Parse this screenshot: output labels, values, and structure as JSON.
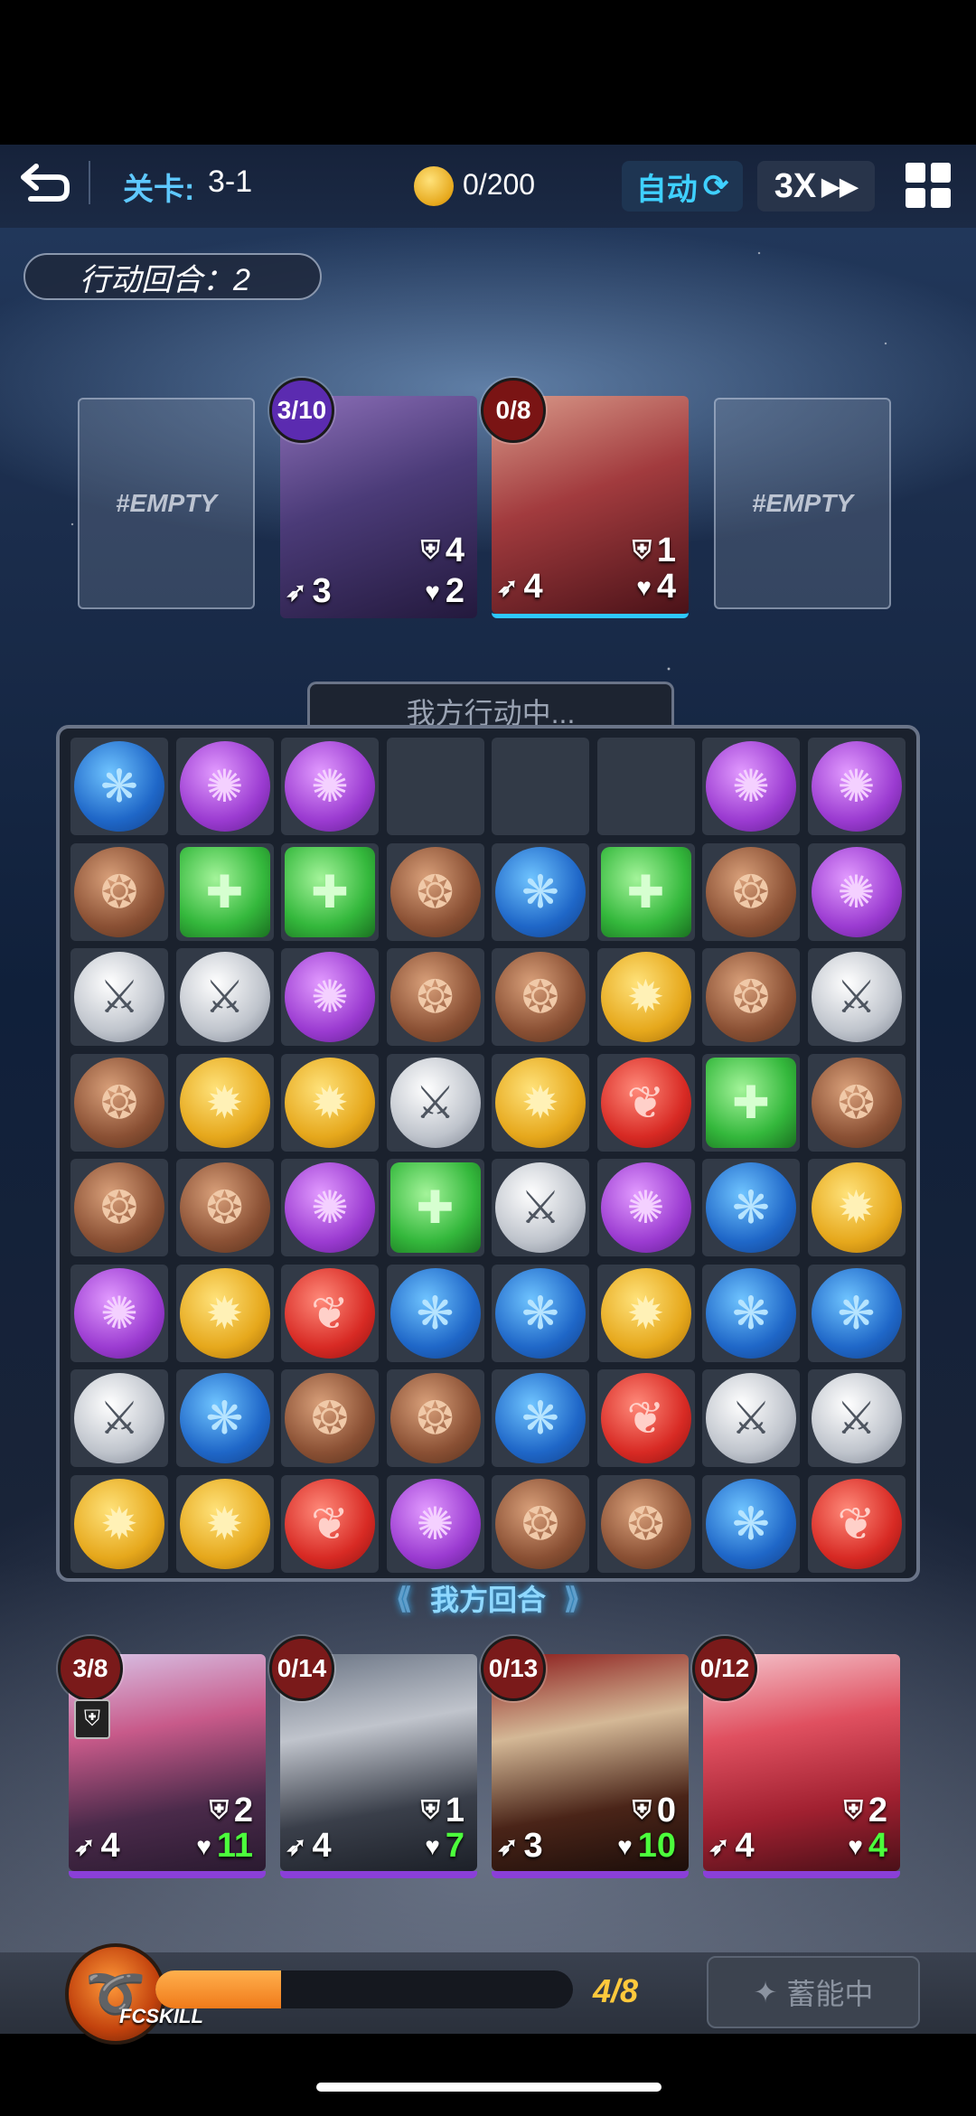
{
  "top_bar": {
    "level_label": "关卡:",
    "level_value": "3-1",
    "coins": "0/200",
    "auto_label": "自动",
    "speed_label": "3X"
  },
  "turn_counter": "行动回合：2",
  "enemies": {
    "empty_left": "#EMPTY",
    "empty_right": "#EMPTY",
    "enemy1": {
      "charge": "3/10",
      "shield": "4",
      "speed": "3",
      "hp": "2"
    },
    "enemy2": {
      "charge": "0/8",
      "shield": "1",
      "speed": "4",
      "hp": "4"
    }
  },
  "board": {
    "header": "我方行动中...",
    "footer": "我方回合",
    "grid": [
      [
        "blue",
        "purple",
        "purple",
        "",
        "",
        "",
        "purple",
        "purple"
      ],
      [
        "brown",
        "green",
        "green",
        "brown",
        "blue",
        "green",
        "brown",
        "purple"
      ],
      [
        "silver",
        "silver",
        "purple",
        "brown",
        "brown",
        "gold",
        "brown",
        "silver"
      ],
      [
        "brown",
        "gold",
        "gold",
        "silver",
        "gold",
        "red",
        "green",
        "brown"
      ],
      [
        "brown",
        "brown",
        "purple",
        "green",
        "silver",
        "purple",
        "blue",
        "gold"
      ],
      [
        "purple",
        "gold",
        "red",
        "blue",
        "blue",
        "gold",
        "blue",
        "blue"
      ],
      [
        "silver",
        "blue",
        "brown",
        "brown",
        "blue",
        "red",
        "silver",
        "silver"
      ],
      [
        "gold",
        "gold",
        "red",
        "purple",
        "brown",
        "brown",
        "blue",
        "red"
      ]
    ]
  },
  "heroes": [
    {
      "charge": "3/8",
      "shield": "2",
      "speed": "4",
      "hp": "11"
    },
    {
      "charge": "0/14",
      "shield": "1",
      "speed": "4",
      "hp": "7"
    },
    {
      "charge": "0/13",
      "shield": "0",
      "speed": "3",
      "hp": "10"
    },
    {
      "charge": "0/12",
      "shield": "2",
      "speed": "4",
      "hp": "4"
    }
  ],
  "skill": {
    "emblem_label": "FCSKILL",
    "energy_text": "4/8",
    "energy_fraction": 0.3,
    "charge_button": "蓄能中"
  },
  "colors": {
    "accent_cyan": "#3fd0ff",
    "energy_orange": "#f07a1a",
    "hp_green": "#4cff3c",
    "enemy_badge_purple": "#5b2bb0",
    "enemy_badge_red": "#7a1414",
    "hero_badge": "#7a1a1a"
  }
}
